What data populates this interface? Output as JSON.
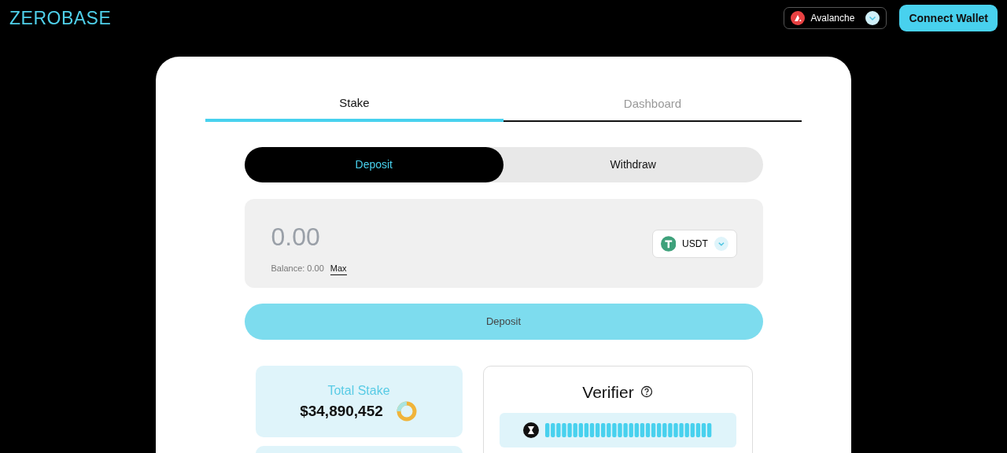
{
  "header": {
    "logo": "ZEROBASE",
    "network": "Avalanche",
    "connect_button": "Connect Wallet"
  },
  "tabs": [
    {
      "label": "Stake",
      "selected": true
    },
    {
      "label": "Dashboard",
      "selected": false
    }
  ],
  "modes": [
    {
      "label": "Deposit",
      "selected": true
    },
    {
      "label": "Withdraw",
      "selected": false
    }
  ],
  "amount": {
    "placeholder": "0.00",
    "balance": "Balance: 0.00",
    "max": "Max",
    "token": "USDT"
  },
  "submit_button": "Deposit",
  "stats": [
    {
      "label": "Total Stake",
      "value": "$34,890,452"
    }
  ],
  "verifier": {
    "title": "Verifier"
  }
}
